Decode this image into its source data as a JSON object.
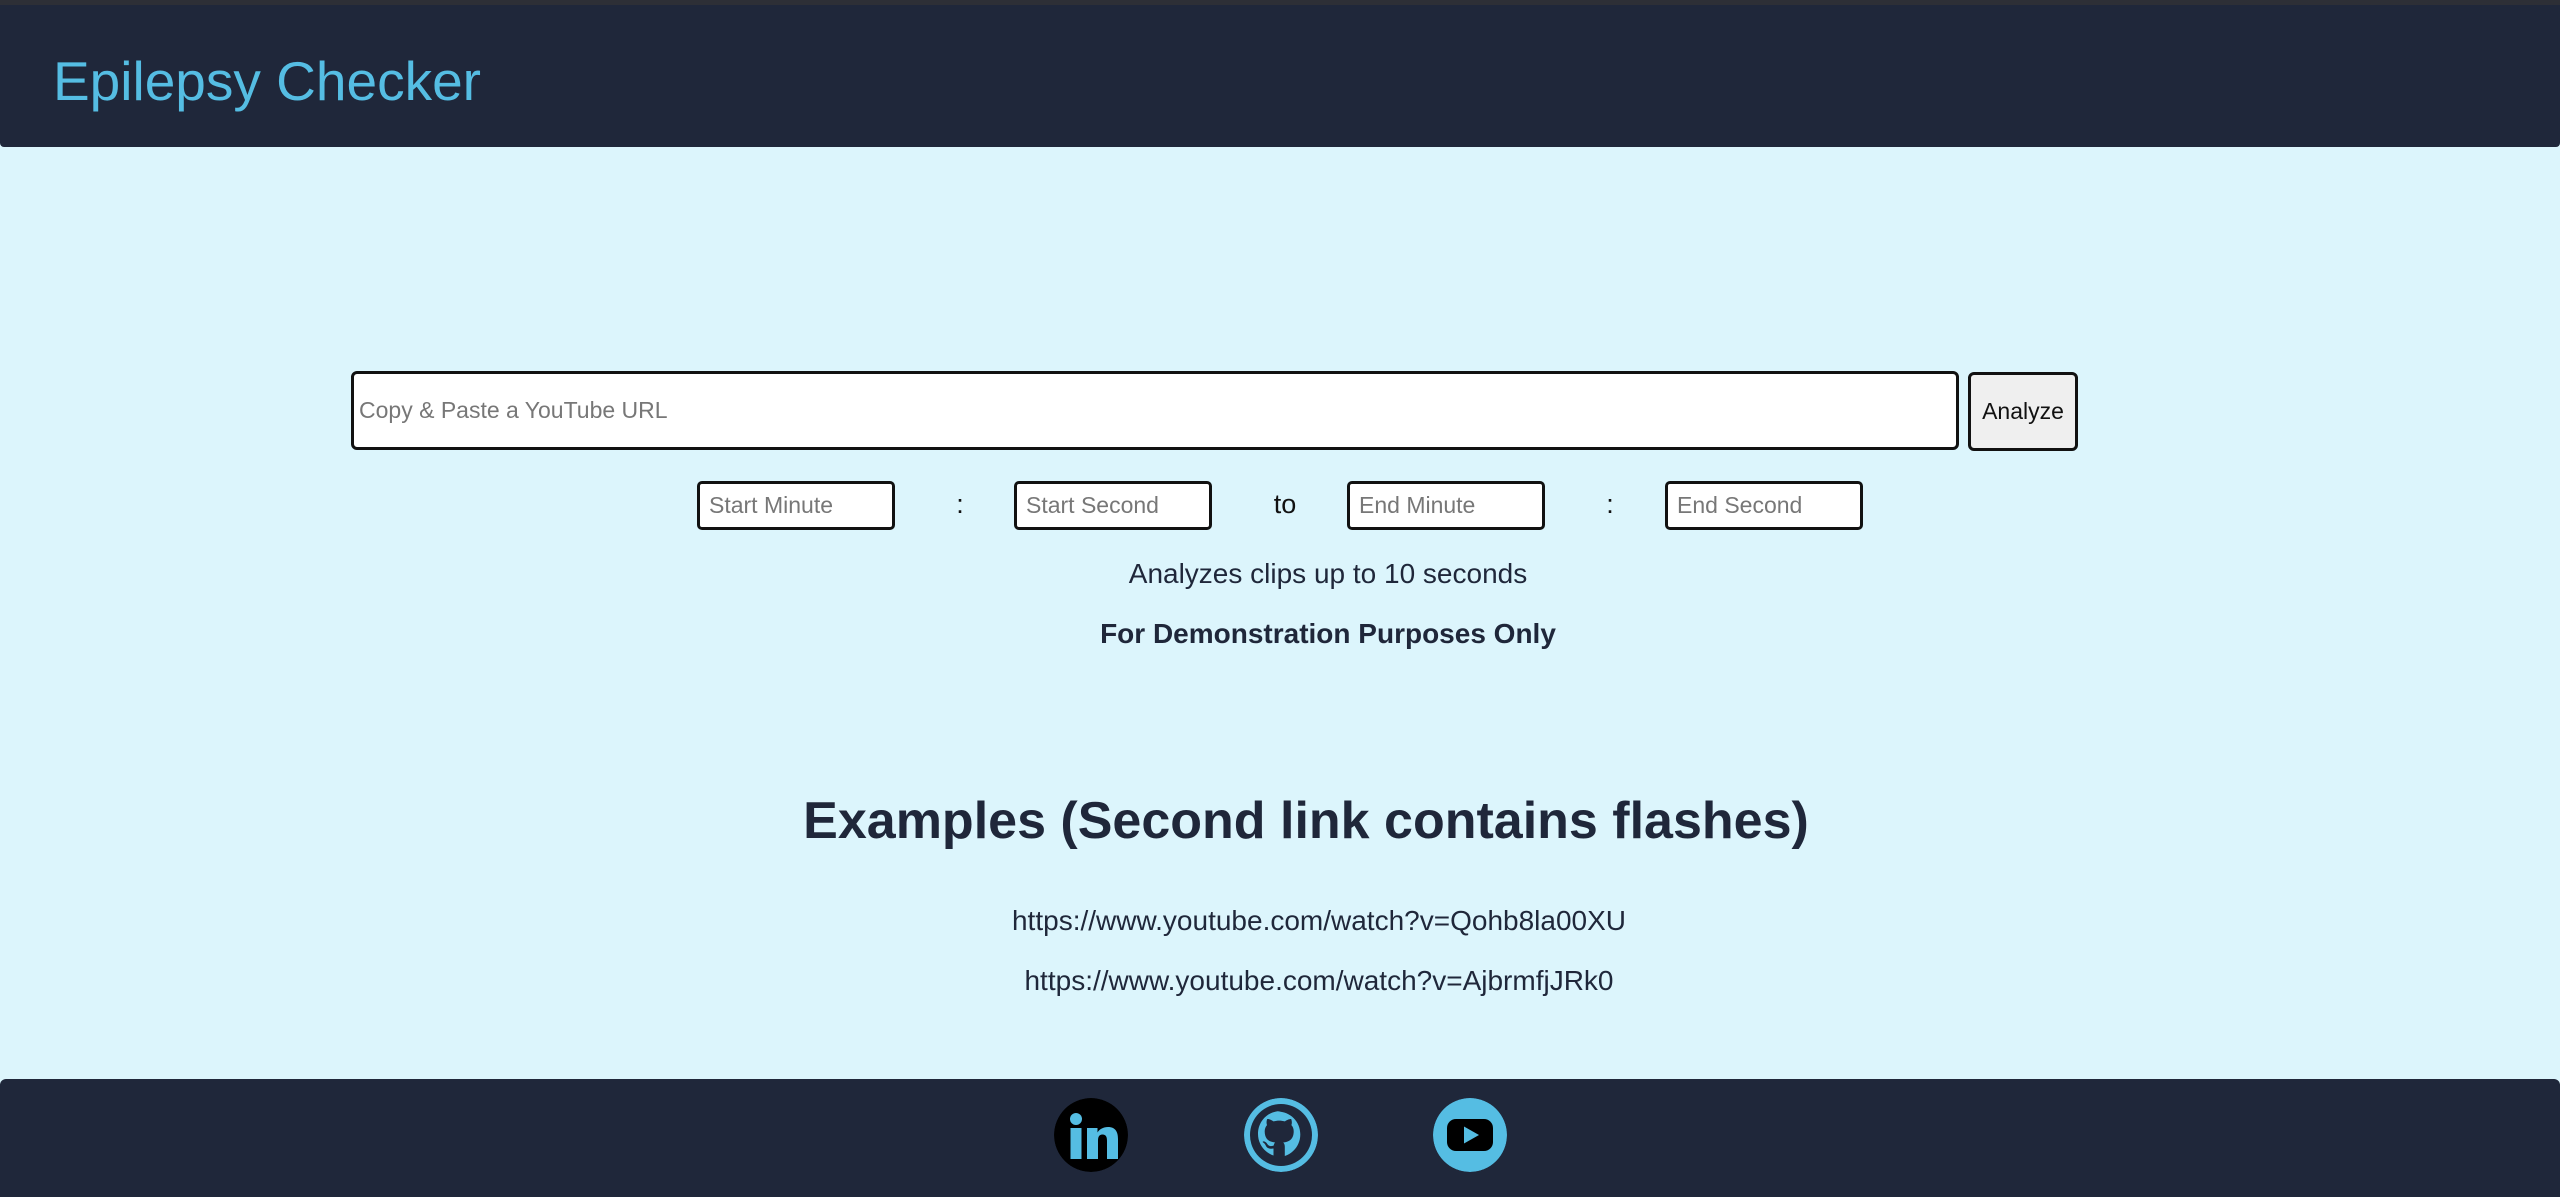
{
  "header": {
    "title": "Epilepsy Checker"
  },
  "form": {
    "url_placeholder": "Copy & Paste a YouTube URL",
    "url_value": "",
    "analyze_label": "Analyze",
    "start_minute_placeholder": "Start Minute",
    "start_second_placeholder": "Start Second",
    "end_minute_placeholder": "End Minute",
    "end_second_placeholder": "End Second",
    "colon": ":",
    "to_label": "to"
  },
  "notes": {
    "limit": "Analyzes clips up to 10 seconds",
    "disclaimer": "For Demonstration Purposes Only"
  },
  "examples": {
    "heading": "Examples (Second link contains flashes)",
    "links": [
      "https://www.youtube.com/watch?v=Qohb8la00XU",
      "https://www.youtube.com/watch?v=AjbrmfjJRk0"
    ]
  },
  "footer": {
    "icons": [
      "linkedin-icon",
      "github-icon",
      "youtube-icon"
    ]
  },
  "colors": {
    "background": "#dcf5fc",
    "header_bg": "#1f273a",
    "accent": "#55bde3"
  }
}
